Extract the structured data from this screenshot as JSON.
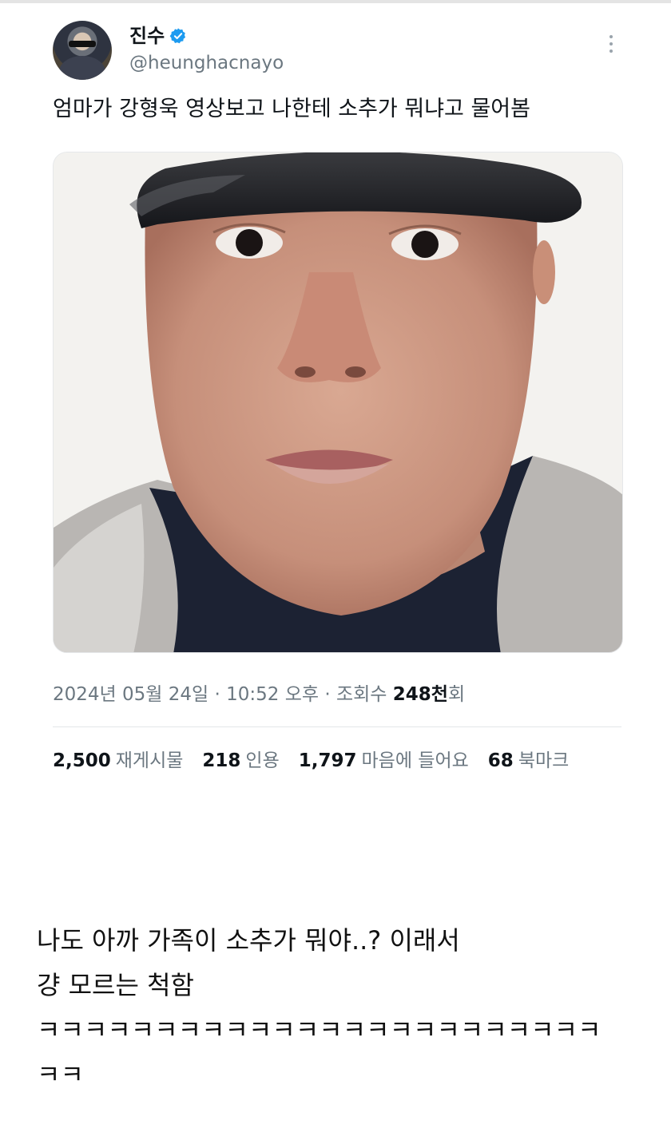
{
  "tweet": {
    "display_name": "진수",
    "handle": "@heunghacnayo",
    "text": "엄마가 강형욱 영상보고 나한테 소추가 뭐냐고 물어봄",
    "date": "2024년 05월 24일",
    "sep1": "·",
    "time": "10:52 오후",
    "sep2": "·",
    "views_label": "조회수",
    "views_value": "248천",
    "views_suffix": "회",
    "stats": {
      "retweets_value": "2,500",
      "retweets_label": "재게시물",
      "quotes_value": "218",
      "quotes_label": "인용",
      "likes_value": "1,797",
      "likes_label": "마음에 들어요",
      "bookmarks_value": "68",
      "bookmarks_label": "북마크"
    }
  },
  "comment": {
    "line1": "나도 아까 가족이 소추가 뭐야..? 이래서",
    "line2": "걍 모르는 척함",
    "line3": "ㅋㅋㅋㅋㅋㅋㅋㅋㅋㅋㅋㅋㅋㅋㅋㅋㅋㅋㅋㅋㅋㅋㅋㅋ",
    "line4": "ㅋㅋ"
  },
  "colors": {
    "verified": "#1d9bf0",
    "muted": "#6b7780"
  }
}
